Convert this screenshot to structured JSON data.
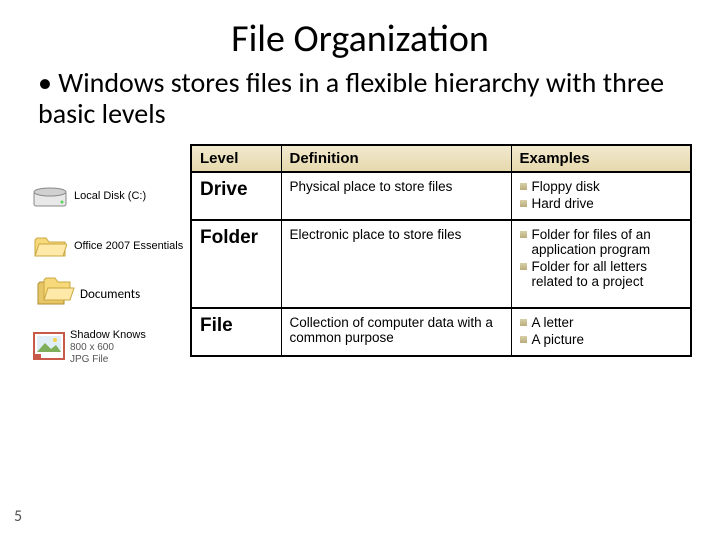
{
  "title": "File Organization",
  "bullet": "Windows stores files in a flexible hierarchy with three basic levels",
  "page_number": "5",
  "icons": {
    "drive_label": "Local Disk (C:)",
    "folder1_label": "Office 2007 Essentials",
    "documents_label": "Documents",
    "shadow": {
      "title": "Shadow Knows",
      "dims": "800 x 600",
      "type": "JPG File"
    }
  },
  "table": {
    "headers": {
      "c1": "Level",
      "c2": "Definition",
      "c3": "Examples"
    },
    "rows": [
      {
        "level": "Drive",
        "definition": "Physical place to store files",
        "examples": [
          "Floppy disk",
          "Hard drive"
        ]
      },
      {
        "level": "Folder",
        "definition": "Electronic place to store files",
        "examples": [
          "Folder for files of an application program",
          "Folder for all letters related to a project"
        ]
      },
      {
        "level": "File",
        "definition": "Collection of computer data with a common purpose",
        "examples": [
          "A letter",
          "A picture"
        ]
      }
    ]
  }
}
